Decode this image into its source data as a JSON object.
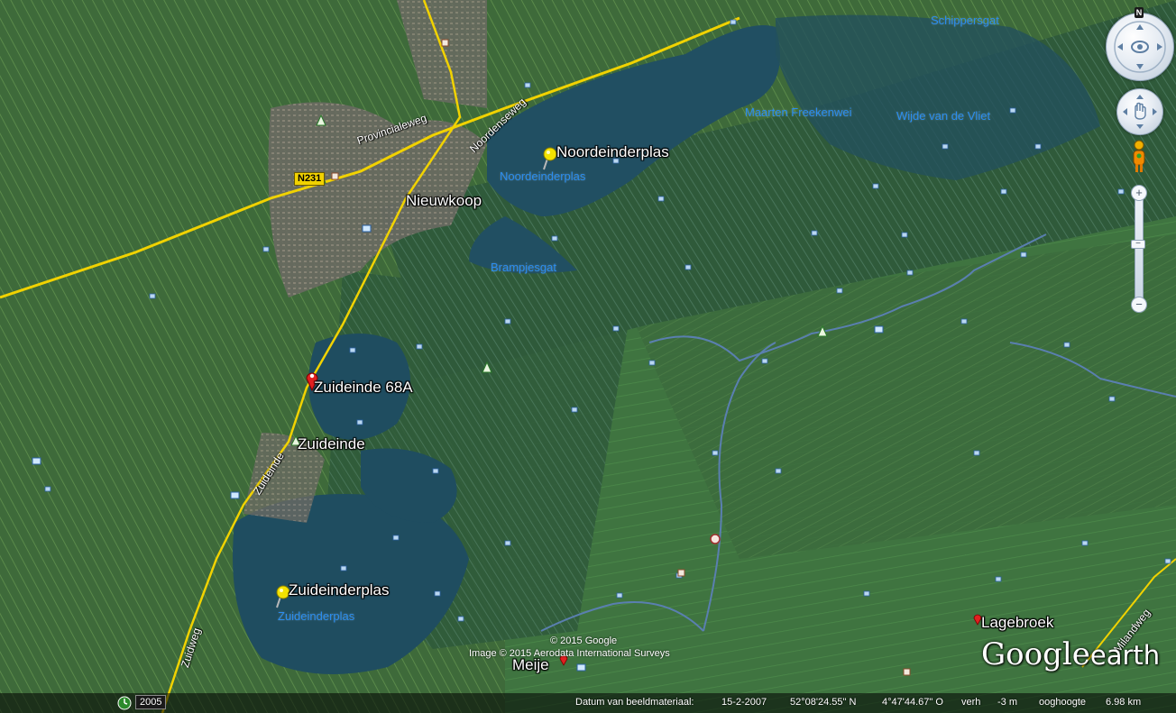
{
  "map": {
    "places": {
      "noordeinderplas": "Noordeinderplas",
      "nieuwkoop": "Nieuwkoop",
      "zuideinde_68a": "Zuideinde 68A",
      "zuideinde": "Zuideinde",
      "zuideinderplas": "Zuideinderplas",
      "meije": "Meije",
      "lagebroek": "Lagebroek"
    },
    "water_labels": {
      "schippersgat": "Schippersgat",
      "maarten_freekenwei": "Maarten Freekenwei",
      "wijde_van_de_vliet": "Wijde van de Vliet",
      "noordeinderplas": "Noordeinderplas",
      "brampjesgat": "Brampjesgat",
      "zuideinderplas": "Zuideinderplas"
    },
    "roads": {
      "provincialeweg": "Provincialeweg",
      "noordenseweg": "Noordenseweg",
      "zuideinde": "Zuideinde",
      "zuidweg": "Zuidweg",
      "milandweg": "Milandweg",
      "shield": "N231"
    },
    "credits": {
      "copyright": "© 2015 Google",
      "imagery": "Image © 2015 Aerodata International Surveys"
    },
    "logo": {
      "google": "Google",
      "earth": "earth"
    }
  },
  "controls": {
    "compass_north": "N",
    "zoom_in": "+",
    "zoom_out": "−"
  },
  "status_bar": {
    "year": "2005",
    "imagery_date_label": "Datum van beeldmateriaal:",
    "imagery_date": "15-2-2007",
    "latitude": "52°08'24.55\" N",
    "longitude": "4°47'44.67\" O",
    "elevation_label": "verh",
    "elevation": "-3 m",
    "eye_alt_label": "ooghoogte",
    "eye_alt": "6.98 km"
  },
  "colors": {
    "water_label": "#2a8df0",
    "road": "#f1d200",
    "pushpin": "#f3e200",
    "red_pin": "#e02020"
  }
}
